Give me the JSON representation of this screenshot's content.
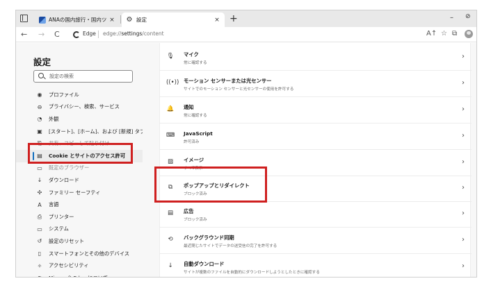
{
  "tabs": [
    {
      "title": "ANAの国内旅行・国内ツアー | ANA",
      "close": "×"
    },
    {
      "title": "設定",
      "close": "×"
    }
  ],
  "new_tab_glyph": "+",
  "window_controls": {
    "minimize": "–",
    "other": "⊘"
  },
  "address": {
    "back": "←",
    "forward": "→",
    "refresh": "C",
    "browser_label": "Edge",
    "scheme": "edge://",
    "path_bold": "settings",
    "path_rest": "/content"
  },
  "toolbar_icons": [
    {
      "name": "read-aloud-icon",
      "glyph": "A↑"
    },
    {
      "name": "favorite-icon",
      "glyph": "☆"
    },
    {
      "name": "collections-icon",
      "glyph": "⧉"
    }
  ],
  "sidebar": {
    "title": "設定",
    "search_placeholder": "設定の検索",
    "items": [
      {
        "icon": "◉",
        "name": "profile",
        "label": "プロファイル"
      },
      {
        "icon": "⊖",
        "name": "privacy",
        "label": "プライバシー、検索、サービス"
      },
      {
        "icon": "◔",
        "name": "appearance",
        "label": "外観"
      },
      {
        "icon": "▣",
        "name": "start-home-newtab",
        "label": "[スタート]、[ホーム]、および [新規] タブ"
      },
      {
        "icon": "⎘",
        "name": "share-copy-paste",
        "label": "共有、コピーして貼り付け",
        "faded": true
      },
      {
        "icon": "▤",
        "name": "cookies-site-permissions",
        "label": "Cookie とサイトのアクセス許可",
        "active": true
      },
      {
        "icon": "▭",
        "name": "default-browser",
        "label": "既定のブラウザー",
        "faded": true
      },
      {
        "icon": "↓",
        "name": "downloads",
        "label": "ダウンロード"
      },
      {
        "icon": "✣",
        "name": "family-safety",
        "label": "ファミリー セーフティ"
      },
      {
        "icon": "A",
        "name": "languages",
        "label": "言語"
      },
      {
        "icon": "⎙",
        "name": "printers",
        "label": "プリンター"
      },
      {
        "icon": "▭",
        "name": "system",
        "label": "システム"
      },
      {
        "icon": "↺",
        "name": "reset-settings",
        "label": "設定のリセット"
      },
      {
        "icon": "▯",
        "name": "phone-devices",
        "label": "スマートフォンとその他のデバイス"
      },
      {
        "icon": "✧",
        "name": "accessibility",
        "label": "アクセシビリティ"
      },
      {
        "icon": "◐",
        "name": "about-edge",
        "label": "Microsoft Edge について"
      }
    ]
  },
  "settings_rows": [
    {
      "icon": "🎙",
      "name": "microphone",
      "title": "マイク",
      "desc": "常に確認する"
    },
    {
      "icon": "((•))",
      "name": "motion-sensors",
      "title": "モーション センサーまたは光センサー",
      "desc": "サイトでのモーション センサーと光センサーの使用を許可する"
    },
    {
      "icon": "🔔",
      "name": "notifications",
      "title": "通知",
      "desc": "常に確認する"
    },
    {
      "icon": "⌨",
      "name": "javascript",
      "title": "JavaScript",
      "desc": "許可済み"
    },
    {
      "icon": "▨",
      "name": "images",
      "title": "イメージ",
      "desc": "すべて表示"
    },
    {
      "icon": "⧉",
      "name": "popups-redirects",
      "title": "ポップアップとリダイレクト",
      "desc": "ブロック済み"
    },
    {
      "icon": "▤",
      "name": "ads",
      "title": "広告",
      "desc": "ブロック済み"
    },
    {
      "icon": "⟲",
      "name": "background-sync",
      "title": "バックグラウンド同期",
      "desc": "最近閉じたサイトでデータの送受信の完了を許可する"
    },
    {
      "icon": "↓",
      "name": "automatic-downloads",
      "title": "自動ダウンロード",
      "desc": "サイトが複数のファイルを自動的にダウンロードしようとしたときに確認する"
    }
  ],
  "chevron": "›",
  "colors": {
    "highlight": "#cf1f1f",
    "accent": "#0f6cbd"
  }
}
